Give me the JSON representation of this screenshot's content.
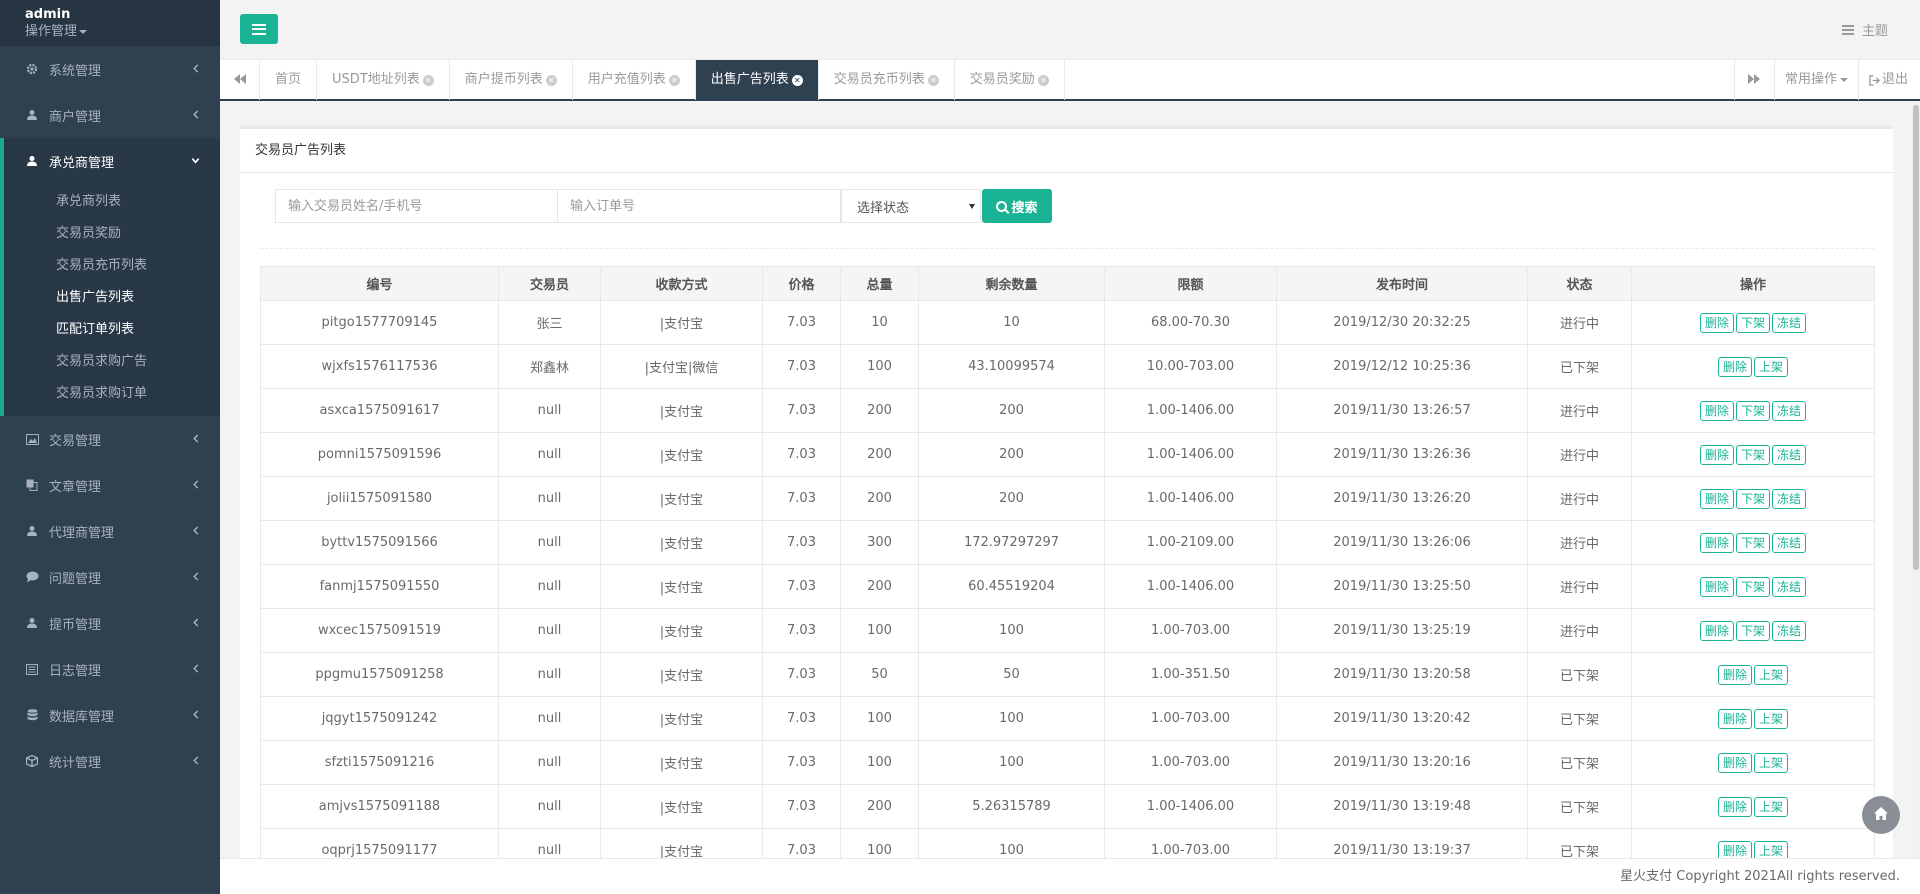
{
  "user": {
    "name": "admin",
    "role": "操作管理"
  },
  "nav": {
    "items_top": [
      {
        "label": "系统管理",
        "icon": "gear-icon"
      },
      {
        "label": "商户管理",
        "icon": "user-icon"
      }
    ],
    "active_group": {
      "label": "承兑商管理",
      "icon": "user-icon",
      "items": [
        {
          "label": "承兑商列表",
          "active": false
        },
        {
          "label": "交易员奖励",
          "active": false
        },
        {
          "label": "交易员充币列表",
          "active": false
        },
        {
          "label": "出售广告列表",
          "active": true
        },
        {
          "label": "匹配订单列表",
          "active": true
        },
        {
          "label": "交易员求购广告",
          "active": false
        },
        {
          "label": "交易员求购订单",
          "active": false
        }
      ]
    },
    "items_bottom": [
      {
        "label": "交易管理",
        "icon": "picture-icon"
      },
      {
        "label": "文章管理",
        "icon": "copy-icon"
      },
      {
        "label": "代理商管理",
        "icon": "user-icon"
      },
      {
        "label": "问题管理",
        "icon": "comment-icon"
      },
      {
        "label": "提币管理",
        "icon": "user-icon"
      },
      {
        "label": "日志管理",
        "icon": "list-icon"
      },
      {
        "label": "数据库管理",
        "icon": "database-icon"
      },
      {
        "label": "统计管理",
        "icon": "cube-icon"
      }
    ]
  },
  "topbar": {
    "theme_label": "主题"
  },
  "tabs": [
    {
      "label": "首页",
      "closable": false,
      "active": false
    },
    {
      "label": "USDT地址列表",
      "closable": true,
      "active": false
    },
    {
      "label": "商户提币列表",
      "closable": true,
      "active": false
    },
    {
      "label": "用户充值列表",
      "closable": true,
      "active": false
    },
    {
      "label": "出售广告列表",
      "closable": true,
      "active": true
    },
    {
      "label": "交易员充币列表",
      "closable": true,
      "active": false
    },
    {
      "label": "交易员奖励",
      "closable": true,
      "active": false
    }
  ],
  "right_tools": {
    "common_ops": "常用操作",
    "logout": "退出"
  },
  "panel": {
    "title": "交易员广告列表"
  },
  "search": {
    "name_placeholder": "输入交易员姓名/手机号",
    "order_placeholder": "输入订单号",
    "status_select": "选择状态",
    "button_label": "搜索"
  },
  "table": {
    "headers": [
      "编号",
      "交易员",
      "收款方式",
      "价格",
      "总量",
      "剩余数量",
      "限额",
      "发布时间",
      "状态",
      "操作"
    ],
    "rows": [
      {
        "id": "pitgo1577709145",
        "trader": "张三",
        "payment": "|支付宝",
        "price": "7.03",
        "total": "10",
        "remaining": "10",
        "limit": "68.00-70.30",
        "time": "2019/12/30 20:32:25",
        "status": "进行中",
        "actions": [
          "删除",
          "下架",
          "冻结"
        ]
      },
      {
        "id": "wjxfs1576117536",
        "trader": "郑鑫林",
        "payment": "|支付宝|微信",
        "price": "7.03",
        "total": "100",
        "remaining": "43.10099574",
        "limit": "10.00-703.00",
        "time": "2019/12/12 10:25:36",
        "status": "已下架",
        "actions": [
          "删除",
          "上架"
        ]
      },
      {
        "id": "asxca1575091617",
        "trader": "null",
        "payment": "|支付宝",
        "price": "7.03",
        "total": "200",
        "remaining": "200",
        "limit": "1.00-1406.00",
        "time": "2019/11/30 13:26:57",
        "status": "进行中",
        "actions": [
          "删除",
          "下架",
          "冻结"
        ]
      },
      {
        "id": "pomni1575091596",
        "trader": "null",
        "payment": "|支付宝",
        "price": "7.03",
        "total": "200",
        "remaining": "200",
        "limit": "1.00-1406.00",
        "time": "2019/11/30 13:26:36",
        "status": "进行中",
        "actions": [
          "删除",
          "下架",
          "冻结"
        ]
      },
      {
        "id": "jolii1575091580",
        "trader": "null",
        "payment": "|支付宝",
        "price": "7.03",
        "total": "200",
        "remaining": "200",
        "limit": "1.00-1406.00",
        "time": "2019/11/30 13:26:20",
        "status": "进行中",
        "actions": [
          "删除",
          "下架",
          "冻结"
        ]
      },
      {
        "id": "byttv1575091566",
        "trader": "null",
        "payment": "|支付宝",
        "price": "7.03",
        "total": "300",
        "remaining": "172.97297297",
        "limit": "1.00-2109.00",
        "time": "2019/11/30 13:26:06",
        "status": "进行中",
        "actions": [
          "删除",
          "下架",
          "冻结"
        ]
      },
      {
        "id": "fanmj1575091550",
        "trader": "null",
        "payment": "|支付宝",
        "price": "7.03",
        "total": "200",
        "remaining": "60.45519204",
        "limit": "1.00-1406.00",
        "time": "2019/11/30 13:25:50",
        "status": "进行中",
        "actions": [
          "删除",
          "下架",
          "冻结"
        ]
      },
      {
        "id": "wxcec1575091519",
        "trader": "null",
        "payment": "|支付宝",
        "price": "7.03",
        "total": "100",
        "remaining": "100",
        "limit": "1.00-703.00",
        "time": "2019/11/30 13:25:19",
        "status": "进行中",
        "actions": [
          "删除",
          "下架",
          "冻结"
        ]
      },
      {
        "id": "ppgmu1575091258",
        "trader": "null",
        "payment": "|支付宝",
        "price": "7.03",
        "total": "50",
        "remaining": "50",
        "limit": "1.00-351.50",
        "time": "2019/11/30 13:20:58",
        "status": "已下架",
        "actions": [
          "删除",
          "上架"
        ]
      },
      {
        "id": "jqgyt1575091242",
        "trader": "null",
        "payment": "|支付宝",
        "price": "7.03",
        "total": "100",
        "remaining": "100",
        "limit": "1.00-703.00",
        "time": "2019/11/30 13:20:42",
        "status": "已下架",
        "actions": [
          "删除",
          "上架"
        ]
      },
      {
        "id": "sfzti1575091216",
        "trader": "null",
        "payment": "|支付宝",
        "price": "7.03",
        "total": "100",
        "remaining": "100",
        "limit": "1.00-703.00",
        "time": "2019/11/30 13:20:16",
        "status": "已下架",
        "actions": [
          "删除",
          "上架"
        ]
      },
      {
        "id": "amjvs1575091188",
        "trader": "null",
        "payment": "|支付宝",
        "price": "7.03",
        "total": "200",
        "remaining": "5.26315789",
        "limit": "1.00-1406.00",
        "time": "2019/11/30 13:19:48",
        "status": "已下架",
        "actions": [
          "删除",
          "上架"
        ]
      },
      {
        "id": "oqprj1575091177",
        "trader": "null",
        "payment": "|支付宝",
        "price": "7.03",
        "total": "100",
        "remaining": "100",
        "limit": "1.00-703.00",
        "time": "2019/11/30 13:19:37",
        "status": "已下架",
        "actions": [
          "删除",
          "上架"
        ]
      }
    ]
  },
  "footer": {
    "copyright": "星火支付 Copyright 2021All rights reserved."
  },
  "colors": {
    "accent": "#1ab394",
    "sidebar": "#2f4050",
    "sidebar_dark": "#273542"
  }
}
